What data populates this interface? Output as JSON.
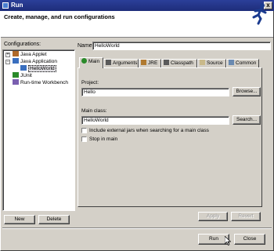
{
  "window": {
    "title": "Run",
    "close_glyph": "x"
  },
  "header": {
    "title": "Create, manage, and run configurations"
  },
  "configurations": {
    "label": "Configurations:",
    "tree": [
      {
        "label": "Java Applet",
        "icon": "applet-icon"
      },
      {
        "label": "Java Application",
        "icon": "java-app-icon",
        "expanded": true,
        "twisty": "−"
      },
      {
        "label": "HelloWorld",
        "icon": "java-class-icon",
        "selected": true
      },
      {
        "label": "JUnit",
        "icon": "junit-icon"
      },
      {
        "label": "Run-time Workbench",
        "icon": "workbench-icon"
      }
    ],
    "tree_twisty_applet": "+",
    "new_label": "New",
    "delete_label": "Delete"
  },
  "form": {
    "name_label": "Name:",
    "name_value": "HelloWorld",
    "tabs": [
      {
        "label": "Main",
        "icon": "main-tab-icon",
        "active": true
      },
      {
        "label": "Arguments",
        "icon": "arguments-icon"
      },
      {
        "label": "JRE",
        "icon": "jre-icon"
      },
      {
        "label": "Classpath",
        "icon": "classpath-icon"
      },
      {
        "label": "Source",
        "icon": "source-icon"
      },
      {
        "label": "Common",
        "icon": "common-icon"
      }
    ],
    "project_label": "Project:",
    "project_value": "Hello",
    "browse_label": "Browse...",
    "main_class_label": "Main class:",
    "main_class_value": "HelloWorld",
    "search_label": "Search...",
    "include_external_jars_label": "Include external jars when searching for a main class",
    "include_external_jars_checked": false,
    "stop_in_main_label": "Stop in main",
    "stop_in_main_checked": false,
    "apply_label": "Apply",
    "revert_label": "Revert"
  },
  "footer": {
    "run_label": "Run",
    "close_label": "Close"
  },
  "colors": {
    "titlebar": "#1e2d7a",
    "dialog_bg": "#d4d0c8",
    "accent_green": "#2a8a2a"
  }
}
